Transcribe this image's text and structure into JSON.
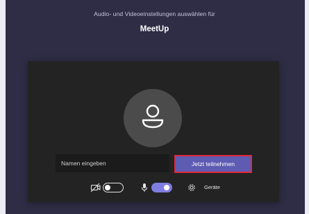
{
  "header": {
    "subtitle": "Audio- und Videoeinstellungen auswählen für",
    "meeting_name": "MeetUp"
  },
  "join_form": {
    "name_placeholder": "Namen eingeben",
    "join_button_label": "Jetzt teilnehmen"
  },
  "controls": {
    "camera": {
      "icon": "camera-off-icon",
      "state": "off"
    },
    "microphone": {
      "icon": "microphone-icon",
      "state": "on"
    },
    "devices": {
      "icon": "gear-icon",
      "label": "Geräte"
    }
  },
  "colors": {
    "background": "#2f2d45",
    "panel": "#232323",
    "accent": "#5e5bb3",
    "toggle_on": "#7f7ee0",
    "focus_border": "#e0283a"
  }
}
